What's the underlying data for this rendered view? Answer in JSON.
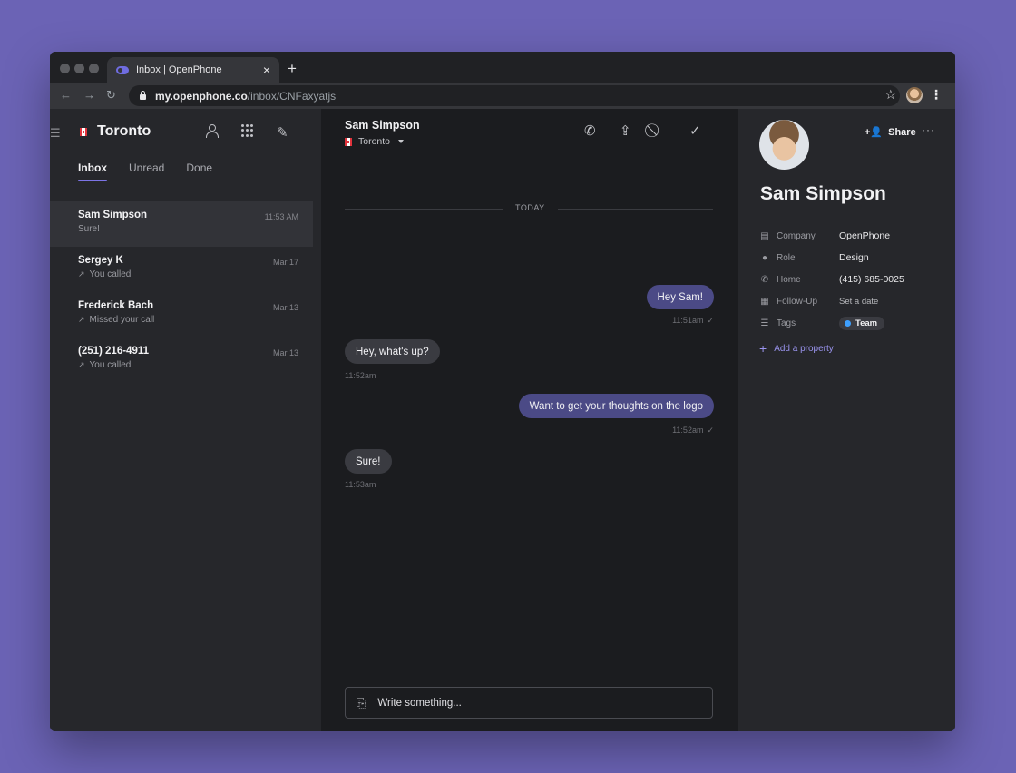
{
  "browser": {
    "tab_title": "Inbox | OpenPhone",
    "tab_close": "×",
    "new_tab": "+",
    "url_host": "my.openphone.co",
    "url_path": "/inbox/CNFaxyatjs"
  },
  "sidebar": {
    "workspace": "Toronto",
    "tabs": [
      {
        "label": "Inbox",
        "active": true
      },
      {
        "label": "Unread",
        "active": false
      },
      {
        "label": "Done",
        "active": false
      }
    ],
    "conversations": [
      {
        "name": "Sam Simpson",
        "date": "11:53 AM",
        "preview": "Sure!",
        "call": false
      },
      {
        "name": "Sergey K",
        "date": "Mar 17",
        "preview": "You called",
        "call": true
      },
      {
        "name": "Frederick Bach",
        "date": "Mar 13",
        "preview": "Missed your call",
        "call": true
      },
      {
        "name": "(251) 216-4911",
        "date": "Mar 13",
        "preview": "You called",
        "call": true
      }
    ]
  },
  "conversation": {
    "contact_name": "Sam Simpson",
    "line": "Toronto",
    "day_label": "TODAY",
    "messages": [
      {
        "text": "Hey Sam!",
        "time": "11:51am",
        "direction": "out"
      },
      {
        "text": "Hey, what's up?",
        "time": "11:52am",
        "direction": "in"
      },
      {
        "text": "Want to get your thoughts on the logo",
        "time": "11:52am",
        "direction": "out"
      },
      {
        "text": "Sure!",
        "time": "11:53am",
        "direction": "in"
      }
    ],
    "composer_placeholder": "Write something..."
  },
  "contact": {
    "name": "Sam Simpson",
    "share_label": "Share",
    "more": "···",
    "properties": [
      {
        "icon": "briefcase-icon",
        "label": "Company",
        "value": "OpenPhone"
      },
      {
        "icon": "person-icon",
        "label": "Role",
        "value": "Design"
      },
      {
        "icon": "phone-icon",
        "label": "Home",
        "value": "(415) 685-0025"
      },
      {
        "icon": "calendar-icon",
        "label": "Follow-Up",
        "value": "Set a date"
      },
      {
        "icon": "list-icon",
        "label": "Tags",
        "value": "Team"
      }
    ],
    "add_property": "Add a property",
    "tag_color": "#3ea0ff"
  },
  "colors": {
    "accent": "#7c74e6",
    "outgoing_bubble": "#4b4a86",
    "background": "#6b63b5"
  }
}
